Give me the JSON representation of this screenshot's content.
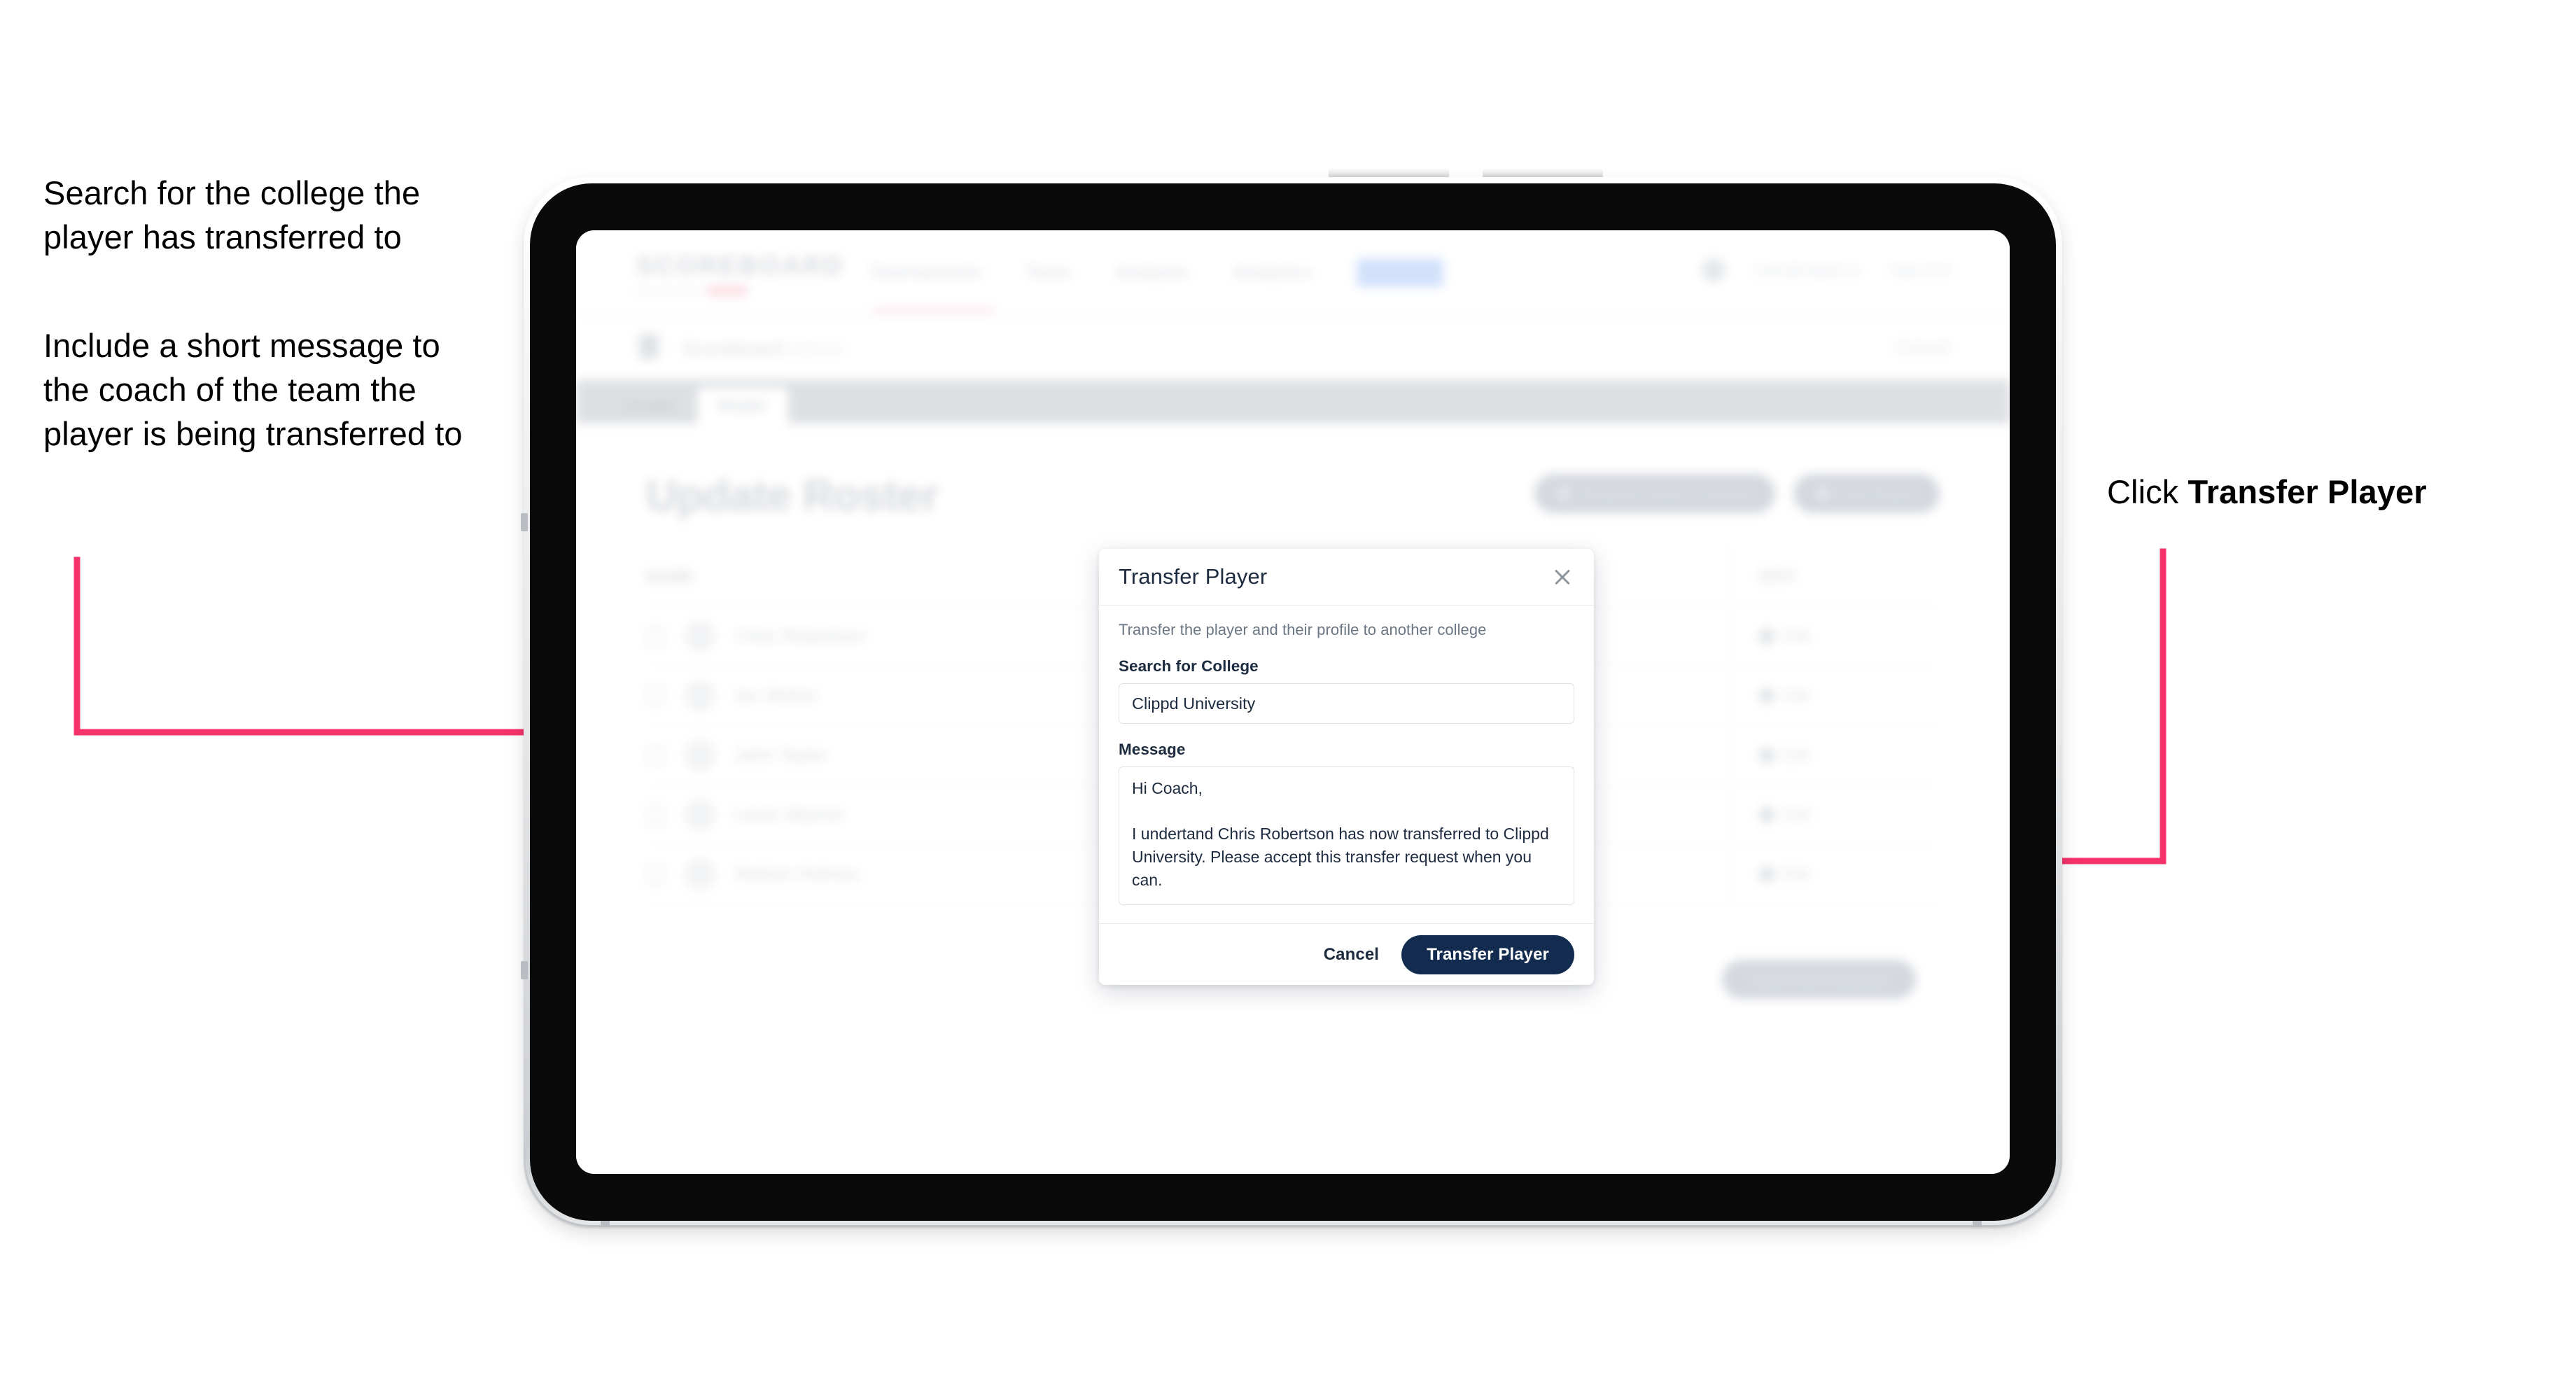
{
  "annotations": {
    "left_1": "Search for the college the player has transferred to",
    "left_2": "Include a short message to the coach of the team the player is being transferred to",
    "right_prefix": "Click ",
    "right_bold": "Transfer Player"
  },
  "colors": {
    "arrow": "#F5336B",
    "accent_navy": "#122B4F",
    "text_dark": "#1D2B3F",
    "muted": "#6B7684",
    "border": "#DFE3E8"
  },
  "device": {
    "type": "tablet",
    "buttons": [
      "volume-up",
      "volume-down",
      "power",
      "side-button"
    ]
  },
  "app": {
    "brand": {
      "wordmark": "SCOREBOARD",
      "tagline": "Powered by",
      "tagline_badge": ""
    },
    "nav_links": [
      {
        "label": "Tournaments",
        "active": true,
        "pill": false
      },
      {
        "label": "Team",
        "active": false,
        "pill": false
      },
      {
        "label": "Analysis",
        "active": false,
        "pill": false
      },
      {
        "label": "Analytics",
        "active": false,
        "pill": false
      },
      {
        "label": "Admin",
        "active": false,
        "pill": true
      }
    ],
    "nav_right": {
      "user": "user@clippd.io",
      "signout": "Sign Out"
    },
    "breadcrumb": {
      "primary": "Scoreboard",
      "secondary": "Admin",
      "right": "Cancel"
    },
    "tabs": [
      {
        "label": "Details",
        "active": false
      },
      {
        "label": "Roster",
        "active": true
      }
    ],
    "page_title": "Update Roster",
    "page_actions": [
      {
        "label": "Request Player Transfer",
        "icon": "transfer-icon"
      },
      {
        "label": "Add Player",
        "icon": "plus-icon"
      }
    ],
    "roster_columns": [
      "NAME",
      "EDIT"
    ],
    "roster_rows": [
      {
        "name": "Chris Robertson",
        "action": "Edit"
      },
      {
        "name": "Ian Weber",
        "action": "Edit"
      },
      {
        "name": "John Taylor",
        "action": "Edit"
      },
      {
        "name": "Lewis Warren",
        "action": "Edit"
      },
      {
        "name": "Nathan Holmes",
        "action": "Edit"
      }
    ],
    "bottom_action": "Save And Continue"
  },
  "modal": {
    "title": "Transfer Player",
    "close_icon": "close-icon",
    "description": "Transfer the player and their profile to another college",
    "college_label": "Search for College",
    "college_value": "Clippd University",
    "college_placeholder": "Search for College",
    "message_label": "Message",
    "message_value": "Hi Coach,\n\nI undertand Chris Robertson has now transferred to Clippd University. Please accept this transfer request when you can.",
    "message_placeholder": "Message",
    "cancel_label": "Cancel",
    "submit_label": "Transfer Player"
  }
}
